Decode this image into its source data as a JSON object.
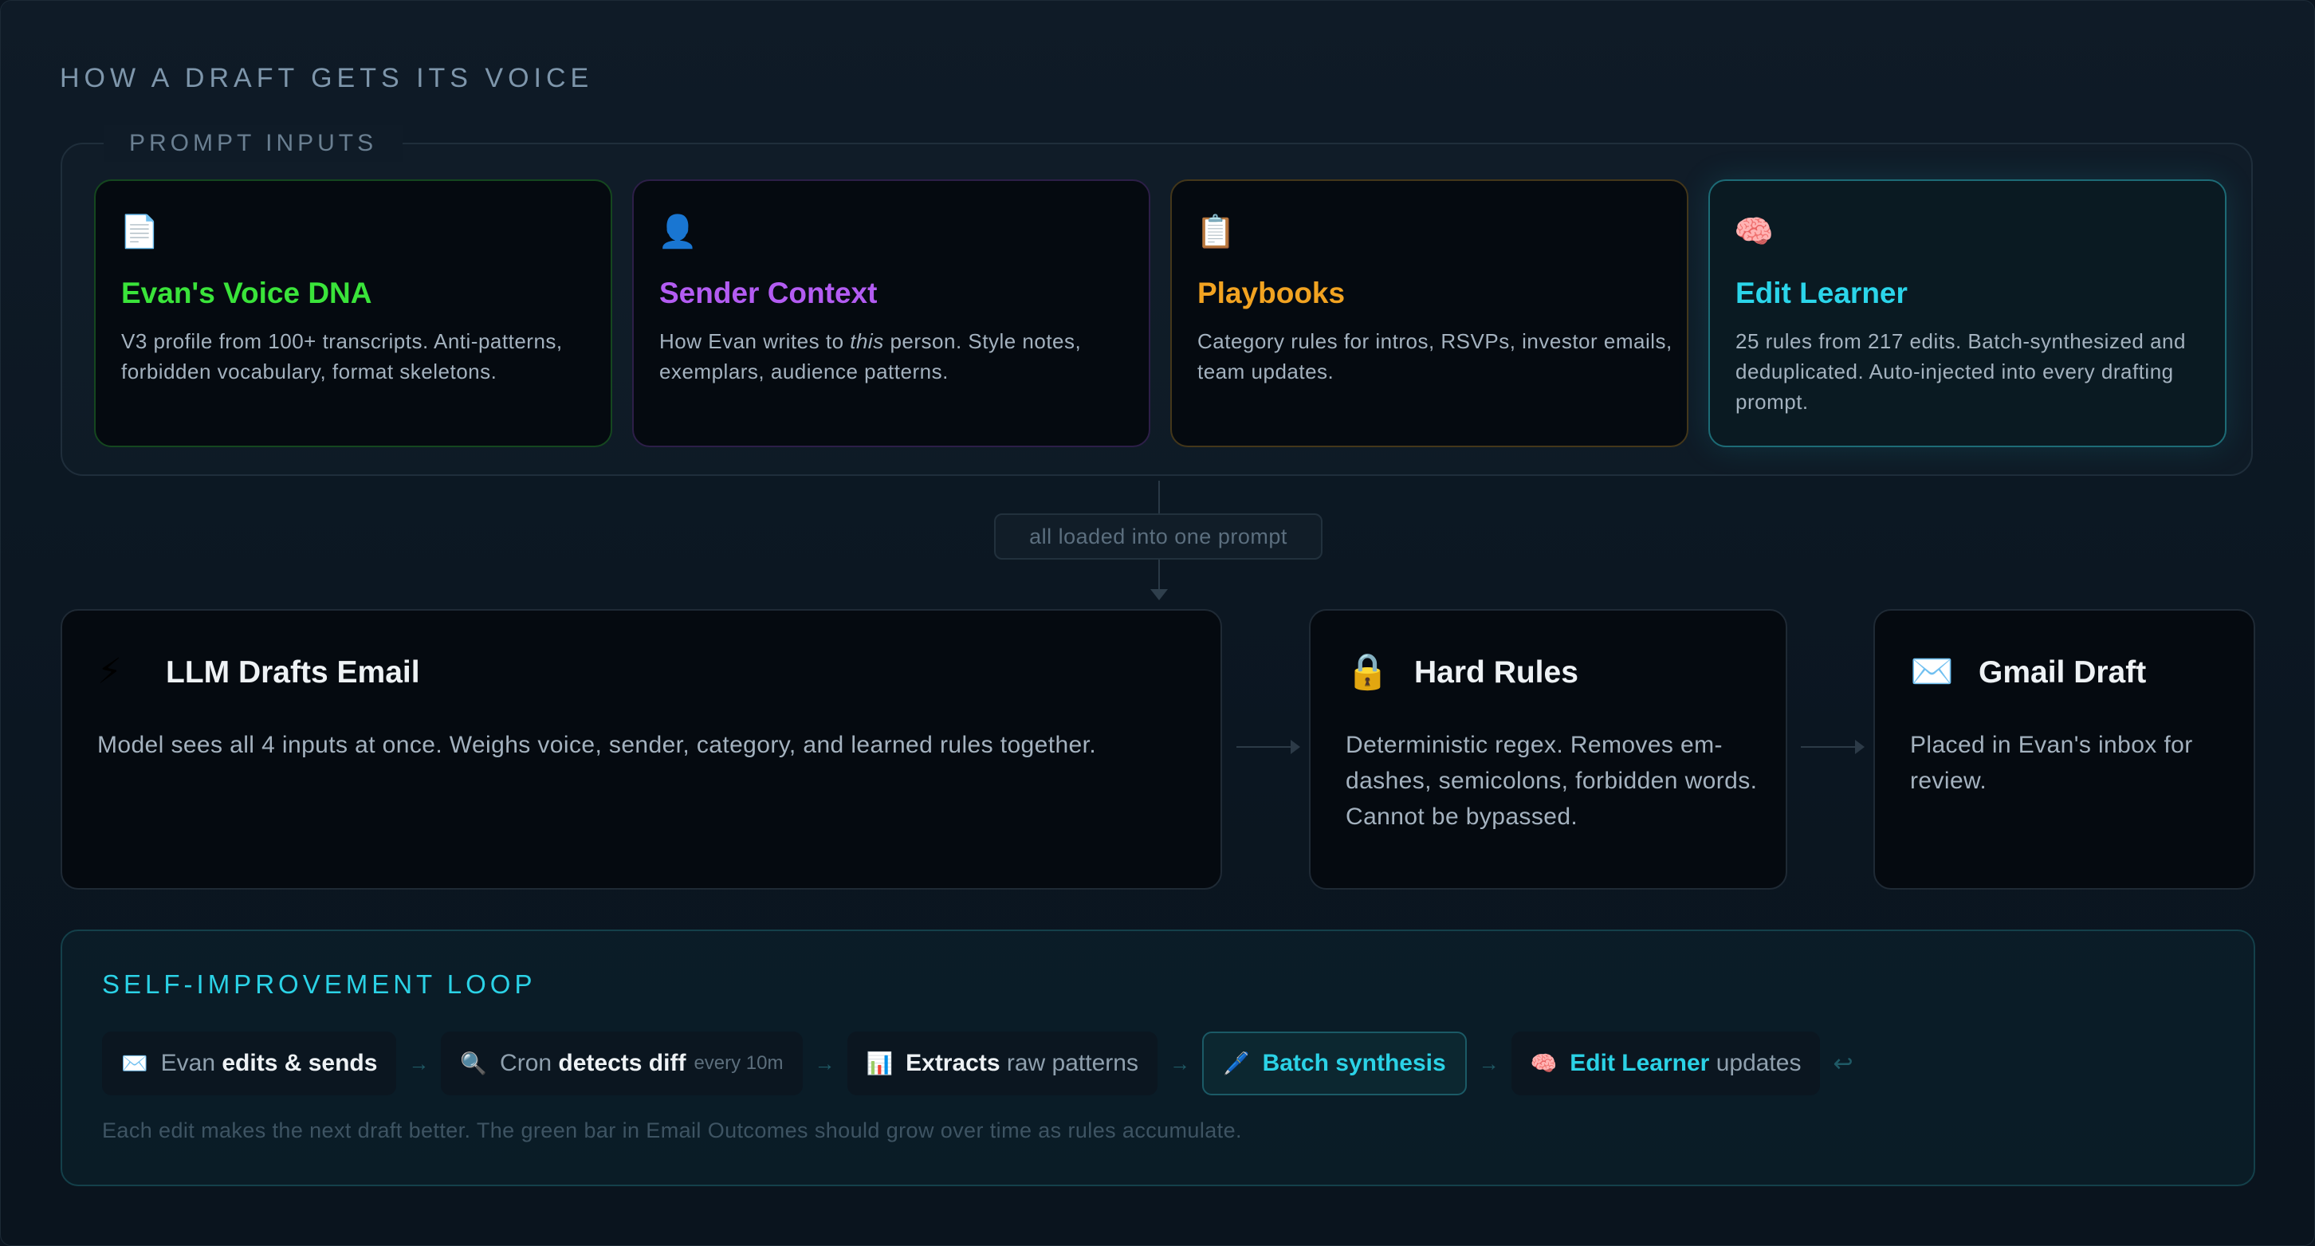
{
  "title": "HOW A DRAFT GETS ITS VOICE",
  "inputs": {
    "legend": "PROMPT INPUTS",
    "cards": [
      {
        "icon": "📄",
        "title": "Evan's Voice DNA",
        "desc": "V3 profile from 100+ transcripts. Anti-patterns, forbidden vocabulary, format skeletons.",
        "accent": "#3ae43a"
      },
      {
        "icon": "👤",
        "title": "Sender Context",
        "desc_before": "How Evan writes to ",
        "desc_em": "this",
        "desc_after": " person. Style notes, exemplars, audience patterns.",
        "accent": "#b35cf2"
      },
      {
        "icon": "📋",
        "title": "Playbooks",
        "desc": "Category rules for intros, RSVPs, investor emails, team updates.",
        "accent": "#f2a321"
      },
      {
        "icon": "🧠",
        "title": "Edit Learner",
        "desc": "25 rules from 217 edits. Batch-synthesized and deduplicated. Auto-injected into every drafting prompt.",
        "accent": "#2bd5ea"
      }
    ]
  },
  "connector": {
    "label": "all loaded into one prompt"
  },
  "pipeline": [
    {
      "icon": "⚡",
      "title": "LLM Drafts Email",
      "desc": "Model sees all 4 inputs at once. Weighs voice, sender, category, and learned rules together."
    },
    {
      "icon": "🔒",
      "title": "Hard Rules",
      "desc": "Deterministic regex. Removes em-dashes, semicolons, forbidden words. Cannot be bypassed."
    },
    {
      "icon": "✉️",
      "title": "Gmail Draft",
      "desc": "Placed in Evan's inbox for review."
    }
  ],
  "loop": {
    "title": "SELF-IMPROVEMENT LOOP",
    "steps": [
      {
        "icon": "✉️",
        "pre": "Evan ",
        "bold": "edits & sends",
        "post": "",
        "small": ""
      },
      {
        "icon": "🔍",
        "pre": "Cron ",
        "bold": "detects diff",
        "post": "",
        "small": "every 10m"
      },
      {
        "icon": "📊",
        "pre": "",
        "bold": "Extracts",
        "post": " raw patterns",
        "small": ""
      },
      {
        "icon": "🖊️",
        "pre": "",
        "bold": "Batch synthesis",
        "post": "",
        "small": ""
      },
      {
        "icon": "🧠",
        "pre": "",
        "bold": "Edit Learner",
        "post": " updates",
        "small": ""
      }
    ],
    "arrow": "→",
    "return_arrow": "↩",
    "note": "Each edit makes the next draft better. The green bar in Email Outcomes should grow over time as rules accumulate."
  }
}
